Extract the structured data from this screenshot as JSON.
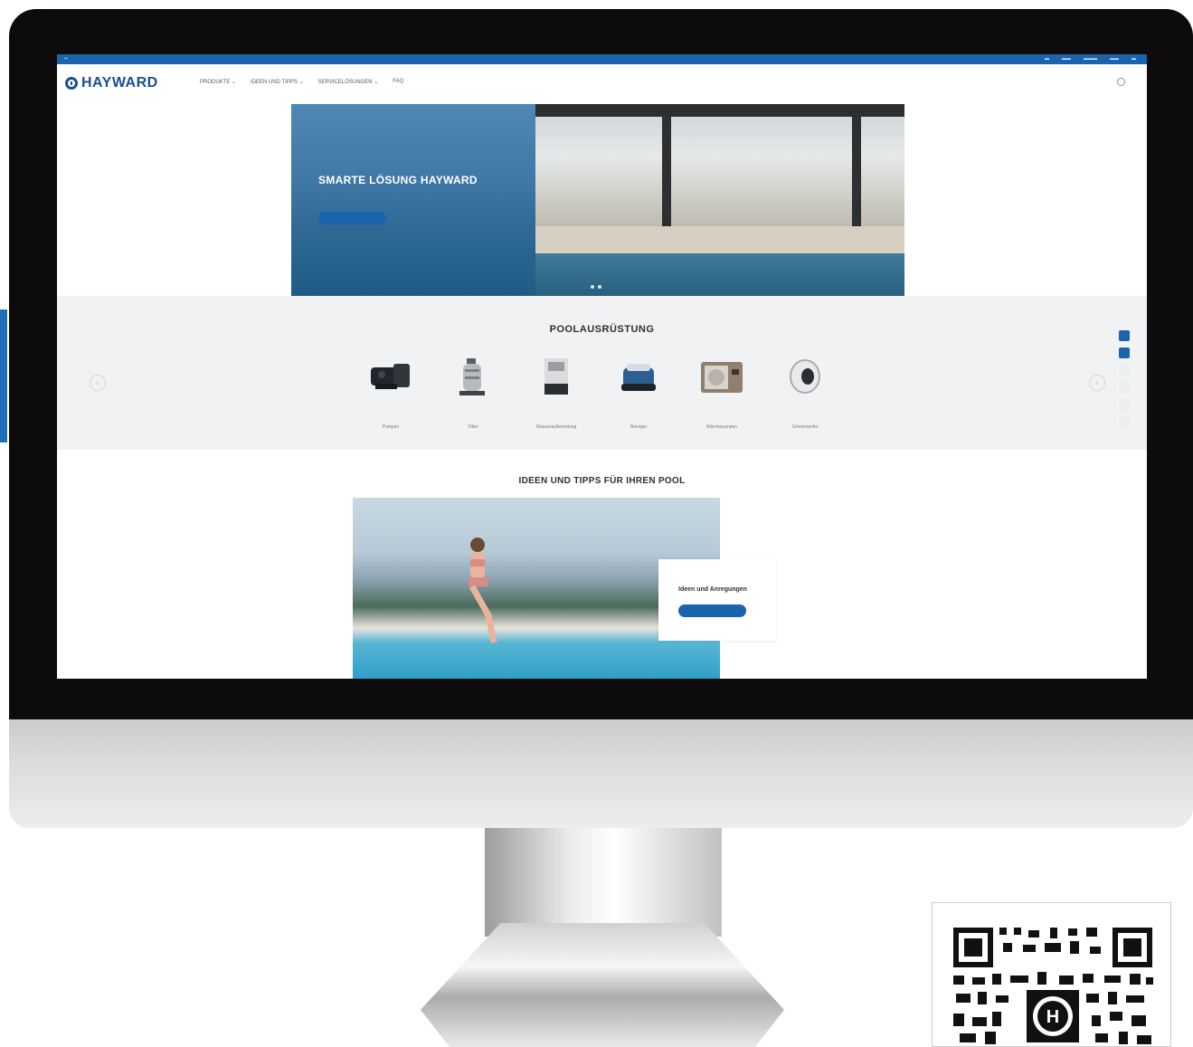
{
  "colors": {
    "brand_blue": "#1a64ad",
    "logo_navy": "#1a4f8f",
    "bezel": "#0d0b0b",
    "section_gray": "#f1f2f3"
  },
  "header": {
    "logo_text": "HAYWARD",
    "menu": [
      {
        "label": "PRODUKTE ⌄"
      },
      {
        "label": "IDEEN UND TIPPS ⌄"
      },
      {
        "label": "SERVICELÖSUNGEN ⌄"
      },
      {
        "label": "FAQ"
      }
    ]
  },
  "hero": {
    "title": "SMARTE LÖSUNG HAYWARD"
  },
  "equipment": {
    "title": "POOLAUSRÜSTUNG",
    "items": [
      {
        "label": "Pumpen",
        "icon": "pump-icon"
      },
      {
        "label": "Filter",
        "icon": "filter-icon"
      },
      {
        "label": "Wasseraufbereitung",
        "icon": "water-treatment-icon"
      },
      {
        "label": "Reiniger",
        "icon": "cleaner-icon"
      },
      {
        "label": "Wärmepumpen",
        "icon": "heat-pump-icon"
      },
      {
        "label": "Scheinwerfer",
        "icon": "light-icon"
      }
    ]
  },
  "ideas": {
    "title": "IDEEN UND TIPPS FÜR IHREN POOL",
    "card_label": "Ideen und Anregungen"
  },
  "qr": {
    "center_letter": "H"
  }
}
